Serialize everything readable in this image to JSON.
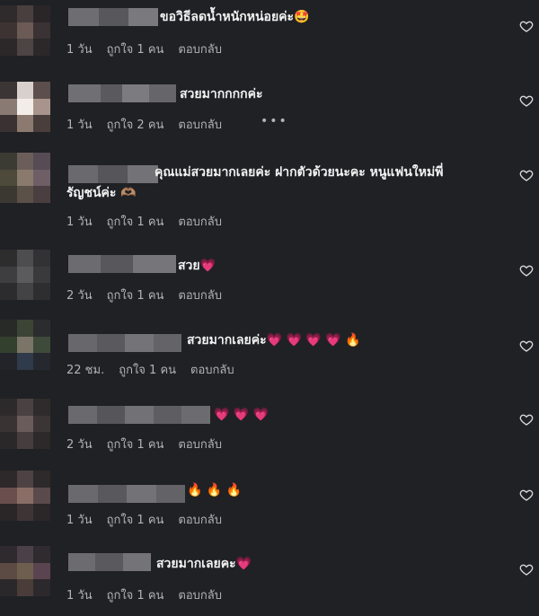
{
  "comments": [
    {
      "text": "ขอวิธีลดน้ำหนักหน่อยค่ะ",
      "emoji": "🤩",
      "time": "1 วัน",
      "likes": "ถูกใจ 1 คน",
      "reply": "ตอบกลับ"
    },
    {
      "text": "สวยมากกกกค่ะ",
      "emoji": "",
      "time": "1 วัน",
      "likes": "ถูกใจ 2 คน",
      "reply": "ตอบกลับ",
      "more": "•••"
    },
    {
      "text": "คุณแม่สวยมากเลยค่ะ ฝากตัวด้วยนะคะ หนูแฟนใหม่พี่",
      "text2": "รัญชน์ค่ะ",
      "emoji": "🫶🏽",
      "time": "1 วัน",
      "likes": "ถูกใจ 1 คน",
      "reply": "ตอบกลับ"
    },
    {
      "text": "สวย",
      "emoji": "💗",
      "time": "2 วัน",
      "likes": "ถูกใจ 1 คน",
      "reply": "ตอบกลับ"
    },
    {
      "text": "สวยมากเลยค่ะ",
      "emoji": "💗 💗 💗 💗 🔥",
      "time": "22 ชม.",
      "likes": "ถูกใจ 1 คน",
      "reply": "ตอบกลับ"
    },
    {
      "text": "",
      "emoji": "💗 💗 💗",
      "time": "2 วัน",
      "likes": "ถูกใจ 1 คน",
      "reply": "ตอบกลับ"
    },
    {
      "text": "",
      "emoji": "🔥 🔥 🔥",
      "time": "1 วัน",
      "likes": "ถูกใจ 1 คน",
      "reply": "ตอบกลับ"
    },
    {
      "text": "สวยมากเลยคะ",
      "emoji": "💗",
      "time": "1 วัน",
      "likes": "ถูกใจ 1 คน",
      "reply": "ตอบกลับ"
    }
  ],
  "icons": {
    "like": "heart-outline-icon"
  },
  "colors": {
    "background": "#202125",
    "text": "#f2f2f2",
    "meta": "#b3b3b3"
  }
}
